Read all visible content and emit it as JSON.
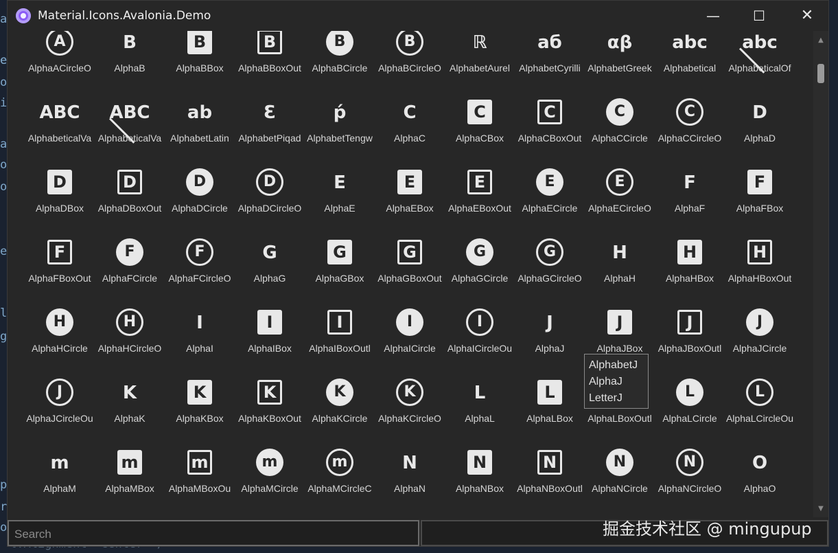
{
  "window": {
    "title": "Material.Icons.Avalonia.Demo",
    "controls": {
      "minimize": "—",
      "maximize": "☐",
      "close": "✕"
    }
  },
  "search": {
    "placeholder": "Search",
    "value": ""
  },
  "tooltip": {
    "lines": [
      "AlphabetJ",
      "AlphaJ",
      "LetterJ"
    ]
  },
  "watermark": "掘金技术社区 @ mingupup",
  "background_left_glyphs": [
    "a",
    "e",
    "e",
    "o",
    "i",
    "a",
    "o",
    "o",
    "e",
    "l",
    "g",
    "p",
    "r",
    "o"
  ],
  "background_bottom_text": "l.Alignment=\"Center\" />",
  "icons": [
    {
      "label": "AlphaACircleO",
      "glyph": "A",
      "style": "circle-outline"
    },
    {
      "label": "AlphaB",
      "glyph": "B",
      "style": "plain"
    },
    {
      "label": "AlphaBBox",
      "glyph": "B",
      "style": "box-filled"
    },
    {
      "label": "AlphaBBoxOut",
      "glyph": "B",
      "style": "box-outline"
    },
    {
      "label": "AlphaBCircle",
      "glyph": "B",
      "style": "circle-filled"
    },
    {
      "label": "AlphaBCircleO",
      "glyph": "B",
      "style": "circle-outline"
    },
    {
      "label": "AlphabetAurel",
      "glyph": "ℝ",
      "style": "plain"
    },
    {
      "label": "AlphabetCyrilli",
      "glyph": "аб",
      "style": "plain"
    },
    {
      "label": "AlphabetGreek",
      "glyph": "αβ",
      "style": "plain"
    },
    {
      "label": "Alphabetical",
      "glyph": "abc",
      "style": "plain"
    },
    {
      "label": "AlphabeticalOf",
      "glyph": "abc",
      "style": "plain-slash"
    },
    {
      "label": "AlphabeticalVa",
      "glyph": "ABC",
      "style": "plain"
    },
    {
      "label": "AlphabeticalVa",
      "glyph": "ABC",
      "style": "plain-slash"
    },
    {
      "label": "AlphabetLatin",
      "glyph": "ab",
      "style": "plain"
    },
    {
      "label": "AlphabetPiqad",
      "glyph": "Ɛ",
      "style": "plain"
    },
    {
      "label": "AlphabetTengw",
      "glyph": "ṕ",
      "style": "plain"
    },
    {
      "label": "AlphaC",
      "glyph": "C",
      "style": "plain"
    },
    {
      "label": "AlphaCBox",
      "glyph": "C",
      "style": "box-filled"
    },
    {
      "label": "AlphaCBoxOut",
      "glyph": "C",
      "style": "box-outline"
    },
    {
      "label": "AlphaCCircle",
      "glyph": "C",
      "style": "circle-filled"
    },
    {
      "label": "AlphaCCircleO",
      "glyph": "C",
      "style": "circle-outline"
    },
    {
      "label": "AlphaD",
      "glyph": "D",
      "style": "plain"
    },
    {
      "label": "AlphaDBox",
      "glyph": "D",
      "style": "box-filled"
    },
    {
      "label": "AlphaDBoxOut",
      "glyph": "D",
      "style": "box-outline"
    },
    {
      "label": "AlphaDCircle",
      "glyph": "D",
      "style": "circle-filled"
    },
    {
      "label": "AlphaDCircleO",
      "glyph": "D",
      "style": "circle-outline"
    },
    {
      "label": "AlphaE",
      "glyph": "E",
      "style": "plain"
    },
    {
      "label": "AlphaEBox",
      "glyph": "E",
      "style": "box-filled"
    },
    {
      "label": "AlphaEBoxOut",
      "glyph": "E",
      "style": "box-outline"
    },
    {
      "label": "AlphaECircle",
      "glyph": "E",
      "style": "circle-filled"
    },
    {
      "label": "AlphaECircleO",
      "glyph": "E",
      "style": "circle-outline"
    },
    {
      "label": "AlphaF",
      "glyph": "F",
      "style": "plain"
    },
    {
      "label": "AlphaFBox",
      "glyph": "F",
      "style": "box-filled"
    },
    {
      "label": "AlphaFBoxOut",
      "glyph": "F",
      "style": "box-outline"
    },
    {
      "label": "AlphaFCircle",
      "glyph": "F",
      "style": "circle-filled"
    },
    {
      "label": "AlphaFCircleO",
      "glyph": "F",
      "style": "circle-outline"
    },
    {
      "label": "AlphaG",
      "glyph": "G",
      "style": "plain"
    },
    {
      "label": "AlphaGBox",
      "glyph": "G",
      "style": "box-filled"
    },
    {
      "label": "AlphaGBoxOut",
      "glyph": "G",
      "style": "box-outline"
    },
    {
      "label": "AlphaGCircle",
      "glyph": "G",
      "style": "circle-filled"
    },
    {
      "label": "AlphaGCircleO",
      "glyph": "G",
      "style": "circle-outline"
    },
    {
      "label": "AlphaH",
      "glyph": "H",
      "style": "plain"
    },
    {
      "label": "AlphaHBox",
      "glyph": "H",
      "style": "box-filled"
    },
    {
      "label": "AlphaHBoxOut",
      "glyph": "H",
      "style": "box-outline"
    },
    {
      "label": "AlphaHCircle",
      "glyph": "H",
      "style": "circle-filled"
    },
    {
      "label": "AlphaHCircleO",
      "glyph": "H",
      "style": "circle-outline"
    },
    {
      "label": "AlphaI",
      "glyph": "I",
      "style": "plain"
    },
    {
      "label": "AlphaIBox",
      "glyph": "I",
      "style": "box-filled"
    },
    {
      "label": "AlphaIBoxOutl",
      "glyph": "I",
      "style": "box-outline"
    },
    {
      "label": "AlphaICircle",
      "glyph": "I",
      "style": "circle-filled"
    },
    {
      "label": "AlphaICircleOu",
      "glyph": "I",
      "style": "circle-outline"
    },
    {
      "label": "AlphaJ",
      "glyph": "J",
      "style": "plain"
    },
    {
      "label": "AlphaJBox",
      "glyph": "J",
      "style": "box-filled"
    },
    {
      "label": "AlphaJBoxOutl",
      "glyph": "J",
      "style": "box-outline"
    },
    {
      "label": "AlphaJCircle",
      "glyph": "J",
      "style": "circle-filled"
    },
    {
      "label": "AlphaJCircleOu",
      "glyph": "J",
      "style": "circle-outline"
    },
    {
      "label": "AlphaK",
      "glyph": "K",
      "style": "plain"
    },
    {
      "label": "AlphaKBox",
      "glyph": "K",
      "style": "box-filled"
    },
    {
      "label": "AlphaKBoxOut",
      "glyph": "K",
      "style": "box-outline"
    },
    {
      "label": "AlphaKCircle",
      "glyph": "K",
      "style": "circle-filled"
    },
    {
      "label": "AlphaKCircleO",
      "glyph": "K",
      "style": "circle-outline"
    },
    {
      "label": "AlphaL",
      "glyph": "L",
      "style": "plain"
    },
    {
      "label": "AlphaLBox",
      "glyph": "L",
      "style": "box-filled"
    },
    {
      "label": "AlphaLBoxOutl",
      "glyph": "L",
      "style": "box-outline"
    },
    {
      "label": "AlphaLCircle",
      "glyph": "L",
      "style": "circle-filled"
    },
    {
      "label": "AlphaLCircleOu",
      "glyph": "L",
      "style": "circle-outline"
    },
    {
      "label": "AlphaM",
      "glyph": "m",
      "style": "plain"
    },
    {
      "label": "AlphaMBox",
      "glyph": "m",
      "style": "box-filled"
    },
    {
      "label": "AlphaMBoxOu",
      "glyph": "m",
      "style": "box-outline"
    },
    {
      "label": "AlphaMCircle",
      "glyph": "m",
      "style": "circle-filled"
    },
    {
      "label": "AlphaMCircleC",
      "glyph": "m",
      "style": "circle-outline"
    },
    {
      "label": "AlphaN",
      "glyph": "N",
      "style": "plain"
    },
    {
      "label": "AlphaNBox",
      "glyph": "N",
      "style": "box-filled"
    },
    {
      "label": "AlphaNBoxOutl",
      "glyph": "N",
      "style": "box-outline"
    },
    {
      "label": "AlphaNCircle",
      "glyph": "N",
      "style": "circle-filled"
    },
    {
      "label": "AlphaNCircleO",
      "glyph": "N",
      "style": "circle-outline"
    },
    {
      "label": "AlphaO",
      "glyph": "O",
      "style": "plain"
    }
  ]
}
